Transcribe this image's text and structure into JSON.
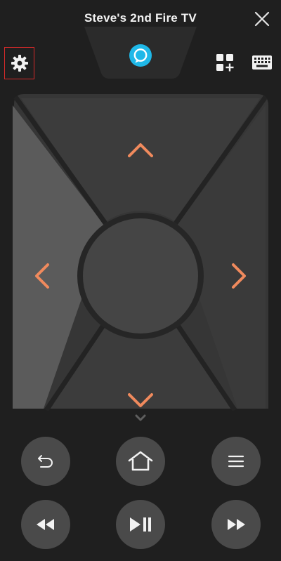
{
  "header": {
    "title": "Steve's 2nd Fire TV"
  },
  "icons": {
    "close": "close-icon",
    "alexa": "alexa-icon",
    "settings": "gear-icon",
    "apps": "apps-add-icon",
    "keyboard": "keyboard-icon",
    "up": "chevron-up-icon",
    "down": "chevron-down-icon",
    "left": "chevron-left-icon",
    "right": "chevron-right-icon",
    "back": "back-icon",
    "home": "home-icon",
    "menu": "menu-icon",
    "rewind": "rewind-icon",
    "play_pause": "play-pause-icon",
    "fast_forward": "fast-forward-icon"
  },
  "colors": {
    "background": "#1f1f1f",
    "dpad_surface": "#3a3a3a",
    "dpad_left_highlight": "#5a5a5a",
    "center_button": "#454545",
    "arrow_accent": "#f08a5d",
    "alexa_blue": "#1fb8e8",
    "settings_highlight_border": "#d42a2a",
    "round_button": "#4a4a4a"
  }
}
